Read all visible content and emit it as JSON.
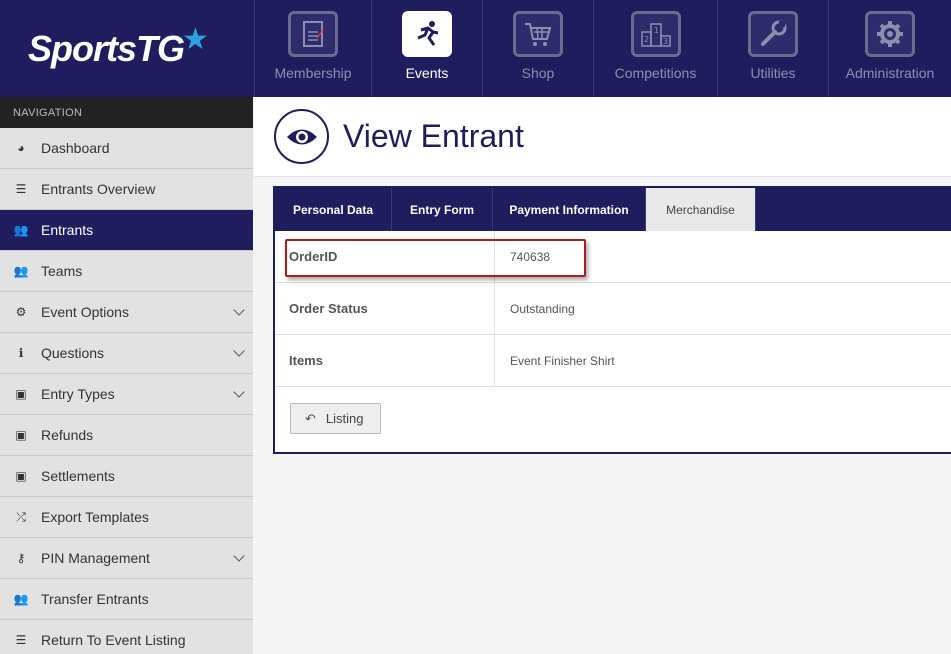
{
  "brand": {
    "logo_text": "SportsTG"
  },
  "topnav": [
    {
      "label": "Membership",
      "icon": "clipboard-icon",
      "active": false
    },
    {
      "label": "Events",
      "icon": "runner-icon",
      "active": true
    },
    {
      "label": "Shop",
      "icon": "cart-icon",
      "active": false
    },
    {
      "label": "Competitions",
      "icon": "podium-icon",
      "active": false
    },
    {
      "label": "Utilities",
      "icon": "wrench-icon",
      "active": false
    },
    {
      "label": "Administration",
      "icon": "gear-icon",
      "active": false
    }
  ],
  "sidebar": {
    "header": "NAVIGATION",
    "items": [
      {
        "label": "Dashboard",
        "icon": "dashboard-icon",
        "expandable": false,
        "active": false
      },
      {
        "label": "Entrants Overview",
        "icon": "list-icon",
        "expandable": false,
        "active": false
      },
      {
        "label": "Entrants",
        "icon": "users-icon",
        "expandable": false,
        "active": true
      },
      {
        "label": "Teams",
        "icon": "users-icon",
        "expandable": false,
        "active": false
      },
      {
        "label": "Event Options",
        "icon": "cogs-icon",
        "expandable": true,
        "active": false
      },
      {
        "label": "Questions",
        "icon": "info-icon",
        "expandable": true,
        "active": false
      },
      {
        "label": "Entry Types",
        "icon": "money-icon",
        "expandable": true,
        "active": false
      },
      {
        "label": "Refunds",
        "icon": "money-icon",
        "expandable": false,
        "active": false
      },
      {
        "label": "Settlements",
        "icon": "money-icon",
        "expandable": false,
        "active": false
      },
      {
        "label": "Export Templates",
        "icon": "shuffle-icon",
        "expandable": false,
        "active": false
      },
      {
        "label": "PIN Management",
        "icon": "key-icon",
        "expandable": true,
        "active": false
      },
      {
        "label": "Transfer Entrants",
        "icon": "users-icon",
        "expandable": false,
        "active": false
      },
      {
        "label": "Return To Event Listing",
        "icon": "list-icon",
        "expandable": false,
        "active": false
      }
    ]
  },
  "page": {
    "title": "View Entrant",
    "icon": "eye-icon"
  },
  "tabs": [
    {
      "label": "Personal Data",
      "active": false
    },
    {
      "label": "Entry Form",
      "active": false
    },
    {
      "label": "Payment Information",
      "active": false
    },
    {
      "label": "Merchandise",
      "active": true
    }
  ],
  "rows": [
    {
      "label": "OrderID",
      "value": "740638"
    },
    {
      "label": "Order Status",
      "value": "Outstanding"
    },
    {
      "label": "Items",
      "value": "Event Finisher Shirt"
    }
  ],
  "listing_button": {
    "label": "Listing"
  },
  "colors": {
    "navy": "#1f1d5e",
    "highlight_red": "#b01c1c",
    "brand_star": "#2aa3e0"
  }
}
